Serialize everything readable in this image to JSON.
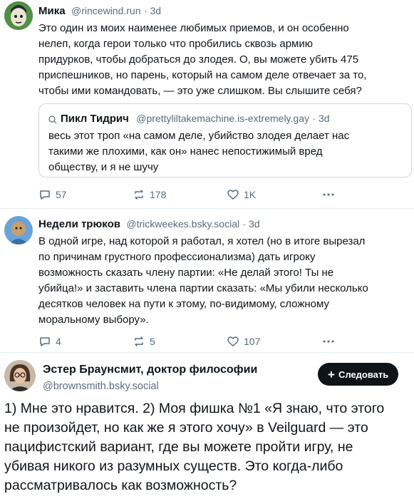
{
  "post1": {
    "author": "Мика",
    "handle": "@rincewind.run",
    "time": "· 3d",
    "lines": [
      "Это один из моих наименее любимых приемов, и он особенно",
      "нелеп, когда герои только что пробились сквозь армию",
      "придурков, чтобы добраться до злодея. О, вы можете убить 475",
      "приспешников, но парень, который на самом деле отвечает за то,",
      "чтобы ими командовать, — это уже слишком. Вы слышите себя?"
    ],
    "quote": {
      "author": "Пикл Тидрич",
      "handle": "@prettyliltakemachine.is-extremely.gay",
      "time": "· 3d",
      "lines": [
        "весь этот троп «на самом деле, убийство злодея делает нас",
        "такими же плохими, как он» нанес непостижимый вред",
        "обществу, и я не шучу"
      ]
    },
    "replies": "57",
    "reposts": "178",
    "likes": "1K"
  },
  "post2": {
    "author": "Недели трюков",
    "handle": "@trickweekes.bsky.social",
    "time": "· 3d",
    "lines": [
      "В одной игре, над которой я работал, я хотел (но в итоге вырезал",
      "по причинам грустного профессионализма) дать игроку",
      "возможность сказать члену партии: «Не делай этого! Ты не",
      "убийца!» и заставить члена партии сказать: «Мы убили несколько",
      "десятков человек на пути к этому, по-видимому, сложному",
      "моральному выбору»."
    ],
    "replies": "4",
    "reposts": "5",
    "likes": "107"
  },
  "post3": {
    "author": "Эстер Браунсмит, доктор философии",
    "handle": "@brownsmith.bsky.social",
    "follow_label": "Следовать",
    "lines": [
      "1) Мне это нравится. 2) Моя фишка №1 «Я знаю, что этого",
      "не произойдет, но как же я этого хочу» в Veilguard — это",
      "пацифистский вариант, где вы можете пройти игру, не",
      "убивая никого из разумных существ. Это когда-либо",
      "рассматривалось как возможность?"
    ]
  },
  "colors": {
    "text": "#0f1419",
    "muted": "#5b6b7c",
    "border": "#cfd9de",
    "button": "#0f1419"
  }
}
